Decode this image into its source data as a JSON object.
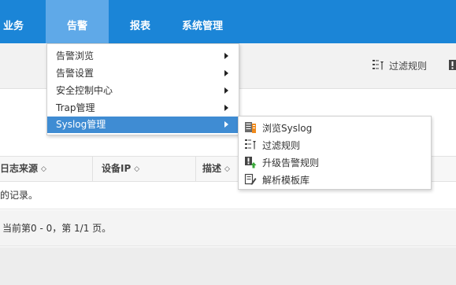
{
  "topnav": {
    "items": [
      {
        "label": "业务",
        "active": false
      },
      {
        "label": "告警",
        "active": true
      },
      {
        "label": "报表",
        "active": false
      },
      {
        "label": "系统管理",
        "active": false
      }
    ]
  },
  "toolbar": {
    "filter_label": "过滤规则"
  },
  "table": {
    "columns": [
      {
        "label": "日志来源"
      },
      {
        "label": "设备IP"
      },
      {
        "label": "描述"
      }
    ],
    "empty_text": "的记录。"
  },
  "pager": {
    "text": "当前第0 - 0，第 1/1 页。"
  },
  "menu": {
    "items": [
      {
        "label": "告警浏览"
      },
      {
        "label": "告警设置"
      },
      {
        "label": "安全控制中心"
      },
      {
        "label": "Trap管理"
      },
      {
        "label": "Syslog管理",
        "selected": true
      }
    ]
  },
  "submenu": {
    "items": [
      {
        "label": "浏览Syslog",
        "icon": "browse-syslog-icon"
      },
      {
        "label": "过滤规则",
        "icon": "filter-rules-icon"
      },
      {
        "label": "升级告警规则",
        "icon": "escalate-alarm-icon"
      },
      {
        "label": "解析模板库",
        "icon": "template-library-icon"
      }
    ]
  },
  "colors": {
    "nav_bg": "#1b85d7",
    "nav_active": "#5fa9e8",
    "menu_selected": "#3f8cd3"
  }
}
